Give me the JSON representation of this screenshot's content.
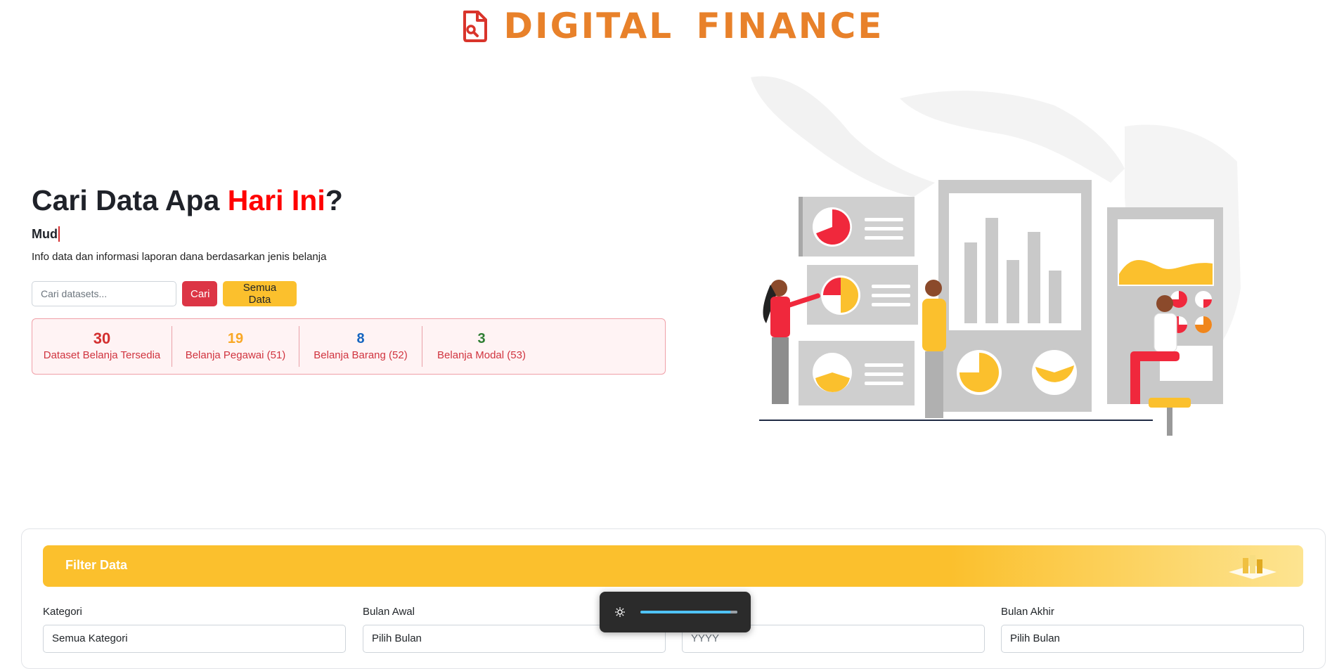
{
  "brand": {
    "name": "DIGITAL  FINANCE",
    "logo_icon": "document-search-icon",
    "color": "#e8812a"
  },
  "hero": {
    "title_main": "Cari Data Apa ",
    "title_accent": "Hari Ini",
    "title_end": "?",
    "typed_text": "Mud",
    "subtitle": "Info data dan informasi laporan dana berdasarkan jenis belanja"
  },
  "search": {
    "placeholder": "Cari datasets...",
    "value": "",
    "search_button": "Cari",
    "all_data_button": "Semua Data"
  },
  "stats": [
    {
      "value": "30",
      "label": "Dataset Belanja Tersedia",
      "color": "#d32f2f"
    },
    {
      "value": "19",
      "label": "Belanja Pegawai (51)",
      "color": "#f9a825"
    },
    {
      "value": "8",
      "label": "Belanja Barang (52)",
      "color": "#1565c0"
    },
    {
      "value": "3",
      "label": "Belanja Modal (53)",
      "color": "#2e7d32"
    }
  ],
  "filter": {
    "title": "Filter Data",
    "fields": [
      {
        "label": "Kategori",
        "value": "Semua Kategori"
      },
      {
        "label": "Bulan Awal",
        "value": "Pilih Bulan"
      },
      {
        "label": "",
        "value": "YYYY"
      },
      {
        "label": "Bulan Akhir",
        "value": "Pilih Bulan"
      }
    ]
  },
  "brightness_overlay": {
    "icon": "brightness-icon",
    "level": 0.92
  },
  "colors": {
    "primary_red": "#dc3545",
    "accent_yellow": "#fbc02d",
    "title_red": "#ff0000"
  }
}
